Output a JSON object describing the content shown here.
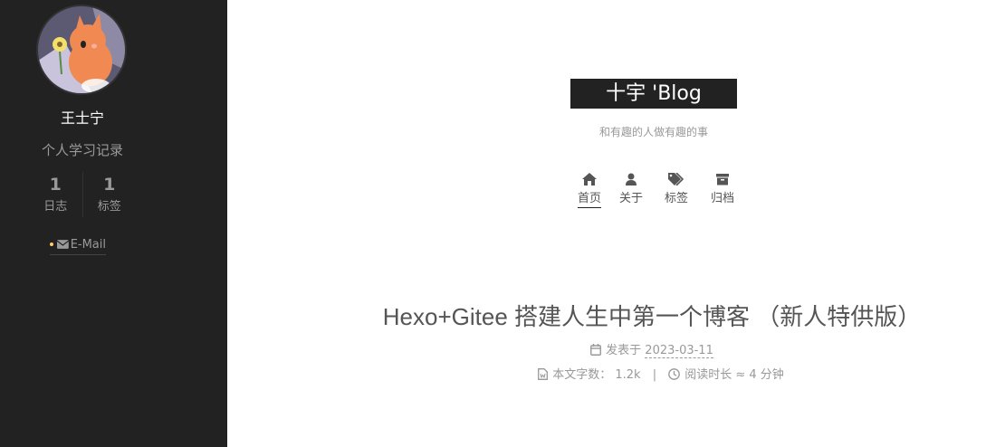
{
  "sidebar": {
    "author": "王士宁",
    "description": "个人学习记录",
    "stats": [
      {
        "count": "1",
        "label": "日志"
      },
      {
        "count": "1",
        "label": "标签"
      }
    ],
    "email_label": "E-Mail"
  },
  "header": {
    "brand": "十宇 'Blog",
    "subtitle": "和有趣的人做有趣的事",
    "menu": [
      {
        "icon": "home-icon",
        "label": "首页",
        "active": true
      },
      {
        "icon": "user-icon",
        "label": "关于",
        "active": false
      },
      {
        "icon": "tags-icon",
        "label": "标签",
        "active": false
      },
      {
        "icon": "archive-icon",
        "label": "归档",
        "active": false
      }
    ]
  },
  "post": {
    "title": "Hexo+Gitee 搭建人生中第一个博客 （新人特供版）",
    "posted_label": "发表于",
    "date": "2023-03-11",
    "wordcount_label": "本文字数：",
    "wordcount": "1.2k",
    "separator": "|",
    "readtime_label": "阅读时长 ≈",
    "readtime": "4 分钟"
  },
  "colors": {
    "sidebar_bg": "#222222",
    "brand_bg": "#222222",
    "email_dot": "#ffcc66"
  }
}
